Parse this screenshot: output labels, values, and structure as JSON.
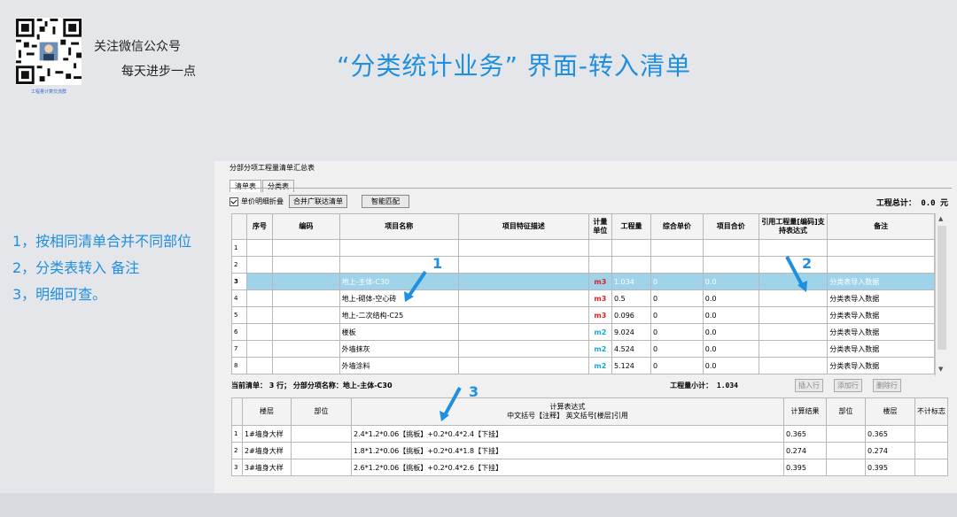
{
  "header": {
    "qr_caption": "工程量计算交流群",
    "follow_line1": "关注微信公众号",
    "follow_line2": "每天进步一点",
    "title": "“分类统计业务” 界面-转入清单"
  },
  "notes": [
    "1，按相同清单合并不同部位",
    "2，分类表转入 备注",
    "3，明细可查。"
  ],
  "annotations": [
    "1",
    "2",
    "3"
  ],
  "app": {
    "window_title": "分部分项工程量清单汇总表",
    "tabs": [
      "清单表",
      "分类表"
    ],
    "toolbar": {
      "checkbox_label": "单价明细折叠",
      "merge_button": "合并广联达清单",
      "match_button": "智能匹配"
    },
    "total_label": "工程总计：  0.0 元",
    "main_table": {
      "headers": [
        "序号",
        "编码",
        "项目名称",
        "项目特征描述",
        "计量单位",
        "工程量",
        "综合单价",
        "项目合价",
        "引用工程量[编码]支持表达式",
        "备注"
      ],
      "rows": [
        {
          "n": "1",
          "name": "",
          "unit": "",
          "qty": "",
          "price": "",
          "total": "",
          "remark": ""
        },
        {
          "n": "2",
          "name": "",
          "unit": "",
          "qty": "",
          "price": "",
          "total": "",
          "remark": ""
        },
        {
          "n": "3",
          "name": "地上-主体-C30",
          "unit": "m3",
          "qty": "1.034",
          "price": "0",
          "total": "0.0",
          "remark": "分类表导入数据"
        },
        {
          "n": "4",
          "name": "地上-砌体-空心砖",
          "unit": "m3",
          "qty": "0.5",
          "price": "0",
          "total": "0.0",
          "remark": "分类表导入数据"
        },
        {
          "n": "5",
          "name": "地上-二次结构-C25",
          "unit": "m3",
          "qty": "0.096",
          "price": "0",
          "total": "0.0",
          "remark": "分类表导入数据"
        },
        {
          "n": "6",
          "name": "楼板",
          "unit": "m2",
          "qty": "9.024",
          "price": "0",
          "total": "0.0",
          "remark": "分类表导入数据"
        },
        {
          "n": "7",
          "name": "外墙抹灰",
          "unit": "m2",
          "qty": "4.524",
          "price": "0",
          "total": "0.0",
          "remark": "分类表导入数据"
        },
        {
          "n": "8",
          "name": "外墙涂料",
          "unit": "m2",
          "qty": "5.124",
          "price": "0",
          "total": "0.0",
          "remark": "分类表导入数据"
        }
      ]
    },
    "status": {
      "current": "当前清单：  3  行；   分部分项名称：地上-主体-C30",
      "subtotal": "工程量小计：  1.034",
      "insert_btn": "插入行",
      "add_btn": "添加行",
      "delete_btn": "删除行"
    },
    "detail_table": {
      "headers": {
        "floor": "楼层",
        "part": "部位",
        "expr_title": "计算表达式",
        "expr_sub": "中文括号【注释】  英文括号[楼层]引用",
        "result": "计算结果",
        "part2": "部位",
        "floor2": "楼层",
        "exclude": "不计标志"
      },
      "rows": [
        {
          "n": "1",
          "floor": "1#墙身大样",
          "expr": "2.4*1.2*0.06【挑板】+0.2*0.4*2.4【下挂】",
          "result": "0.365",
          "floor2": "0.365"
        },
        {
          "n": "2",
          "floor": "2#墙身大样",
          "expr": "1.8*1.2*0.06【挑板】+0.2*0.4*1.8【下挂】",
          "result": "0.274",
          "floor2": "0.274"
        },
        {
          "n": "3",
          "floor": "3#墙身大样",
          "expr": "2.6*1.2*0.06【挑板】+0.2*0.4*2.6【下挂】",
          "result": "0.395",
          "floor2": "0.395"
        }
      ]
    }
  }
}
